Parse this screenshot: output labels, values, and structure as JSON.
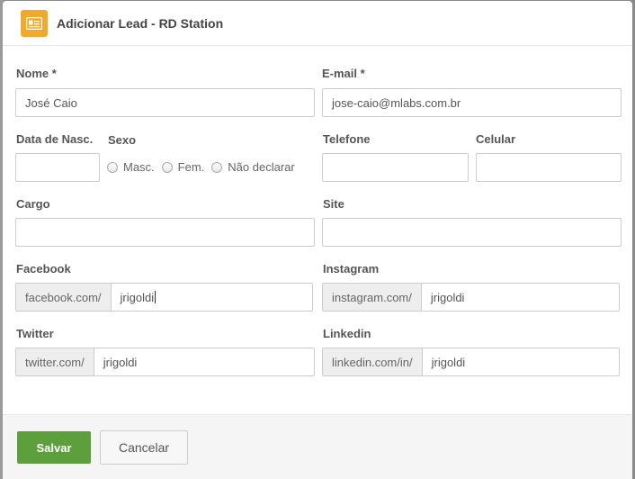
{
  "header": {
    "icon": "contact-card-icon",
    "title": "Adicionar Lead - RD Station",
    "accent_color": "#f0a92a"
  },
  "form": {
    "nome": {
      "label": "Nome *",
      "value": "José Caio"
    },
    "email": {
      "label": "E-mail *",
      "value": "jose-caio@mlabs.com.br"
    },
    "data_nasc": {
      "label": "Data de Nasc.",
      "value": ""
    },
    "sexo": {
      "label": "Sexo",
      "options": [
        "Masc.",
        "Fem.",
        "Não declarar"
      ]
    },
    "telefone": {
      "label": "Telefone",
      "value": ""
    },
    "celular": {
      "label": "Celular",
      "value": ""
    },
    "cargo": {
      "label": "Cargo",
      "value": ""
    },
    "site": {
      "label": "Site",
      "value": ""
    },
    "facebook": {
      "label": "Facebook",
      "prefix": "facebook.com/",
      "value": "jrigoldi"
    },
    "instagram": {
      "label": "Instagram",
      "prefix": "instagram.com/",
      "value": "jrigoldi"
    },
    "twitter": {
      "label": "Twitter",
      "prefix": "twitter.com/",
      "value": "jrigoldi"
    },
    "linkedin": {
      "label": "Linkedin",
      "prefix": "linkedin.com/in/",
      "value": "jrigoldi"
    }
  },
  "footer": {
    "save_label": "Salvar",
    "cancel_label": "Cancelar",
    "save_color": "#5d9e3d"
  }
}
